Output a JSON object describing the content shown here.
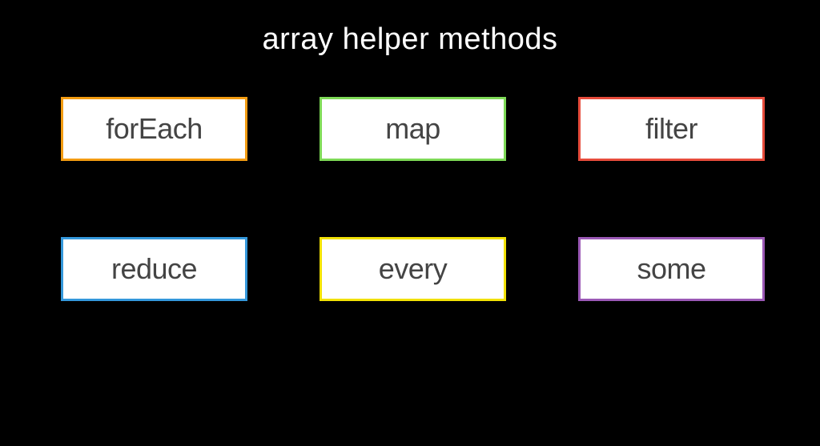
{
  "title": "array helper methods",
  "boxes": {
    "forEach": {
      "label": "forEach",
      "colorClass": "box-orange"
    },
    "map": {
      "label": "map",
      "colorClass": "box-green"
    },
    "filter": {
      "label": "filter",
      "colorClass": "box-red"
    },
    "reduce": {
      "label": "reduce",
      "colorClass": "box-blue"
    },
    "every": {
      "label": "every",
      "colorClass": "box-yellow"
    },
    "some": {
      "label": "some",
      "colorClass": "box-purple"
    }
  }
}
